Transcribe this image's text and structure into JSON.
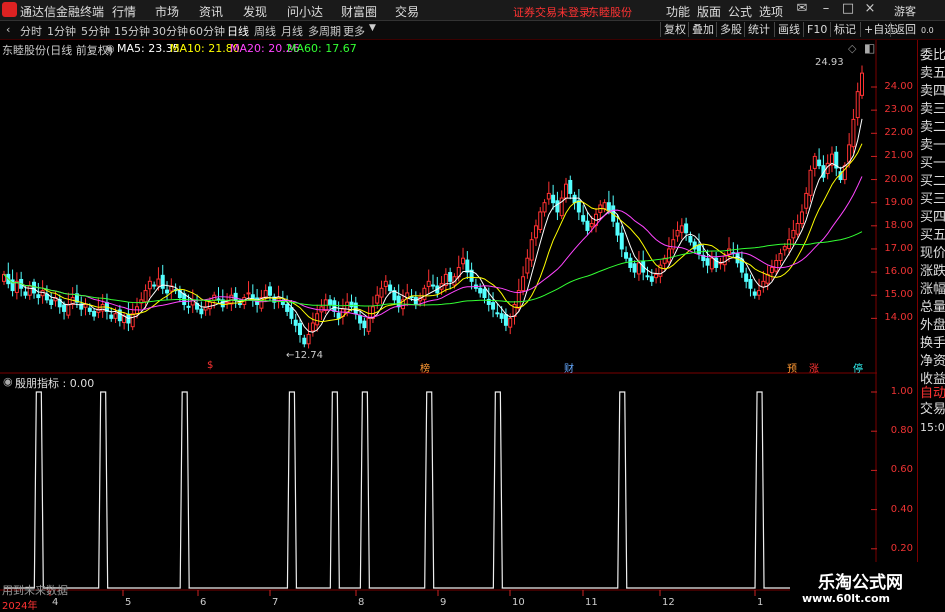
{
  "app": {
    "title": "通达信金融终端"
  },
  "menu": [
    "行情",
    "市场",
    "资讯",
    "发现",
    "问小达",
    "财富圈",
    "交易"
  ],
  "warning": "证券交易未登录",
  "stock_name": "东睦股份",
  "top_right": [
    "功能",
    "版面",
    "公式",
    "选项"
  ],
  "user": "游客",
  "periods": [
    "分时",
    "1分钟",
    "5分钟",
    "15分钟",
    "30分钟",
    "60分钟",
    "日线",
    "周线",
    "月线",
    "多周期",
    "更多"
  ],
  "active_period": "日线",
  "toolbar_buttons": [
    "复权",
    "叠加",
    "多股",
    "统计",
    "画线",
    "F10",
    "标记",
    "+自选",
    "返回"
  ],
  "chart_label": "东睦股份(日线 前复权)",
  "ma": [
    {
      "label": "MA5: 23.35",
      "color": "#ffffff"
    },
    {
      "label": "MA10: 21.80",
      "color": "#ffff00"
    },
    {
      "label": "MA20: 20.26",
      "color": "#ff44ff"
    },
    {
      "label": "MA60: 17.67",
      "color": "#33ff33"
    }
  ],
  "price_axis": [
    "24.00",
    "23.00",
    "22.00",
    "21.00",
    "20.00",
    "19.00",
    "18.00",
    "17.00",
    "16.00",
    "15.00",
    "14.00"
  ],
  "high_label": "24.93",
  "low_label": "12.74",
  "indicator": {
    "label": "殷朋指标 : 0.00",
    "axis": [
      "1.00",
      "0.80",
      "0.60",
      "0.40",
      "0.20"
    ]
  },
  "right_panel": [
    "委比",
    "卖五",
    "卖四",
    "卖三",
    "卖二",
    "卖一",
    "买一",
    "买二",
    "买三",
    "买四",
    "买五",
    "现价",
    "涨跌",
    "涨幅",
    "总量",
    "外盘",
    "换手",
    "净资",
    "收益",
    "自动",
    "交易",
    "15:00"
  ],
  "right_panel_top": "0.0",
  "event_tags": [
    {
      "text": "$",
      "color": "#ff3333"
    },
    {
      "text": "榜",
      "color": "#ff9933"
    },
    {
      "text": "财",
      "color": "#66aaff"
    },
    {
      "text": "预",
      "color": "#ff9933"
    },
    {
      "text": "涨",
      "color": "#ff3333"
    },
    {
      "text": "停",
      "color": "#33ffff"
    }
  ],
  "months": [
    "2024年",
    "4",
    "5",
    "6",
    "7",
    "8",
    "9",
    "10",
    "11",
    "12",
    "1"
  ],
  "footer_hint": "用到未来数据",
  "watermark": {
    "line1": "乐淘公式网",
    "line2": "www.60lt.com"
  },
  "chart_data": {
    "type": "line",
    "title": "",
    "price_range": [
      12.2,
      25.6
    ],
    "closes": [
      15.9,
      15.5,
      15.2,
      15.6,
      15.3,
      15.0,
      15.4,
      15.1,
      14.9,
      15.2,
      14.8,
      14.6,
      14.9,
      14.5,
      14.3,
      14.6,
      14.9,
      14.7,
      14.4,
      14.6,
      14.3,
      14.1,
      14.4,
      14.6,
      14.3,
      14.0,
      14.2,
      13.9,
      14.1,
      13.8,
      14.2,
      14.5,
      14.8,
      15.2,
      15.6,
      15.4,
      15.7,
      15.3,
      15.1,
      15.4,
      15.2,
      14.9,
      14.6,
      14.5,
      14.8,
      14.4,
      14.2,
      14.5,
      14.7,
      15.0,
      14.8,
      14.5,
      14.7,
      15.0,
      14.8,
      14.6,
      14.9,
      15.1,
      14.8,
      14.6,
      14.9,
      15.2,
      15.0,
      14.7,
      14.9,
      14.6,
      14.3,
      14.0,
      13.7,
      13.3,
      12.9,
      13.3,
      13.8,
      14.2,
      14.5,
      14.8,
      14.6,
      14.3,
      14.0,
      14.4,
      14.7,
      14.5,
      14.2,
      13.8,
      13.6,
      14.0,
      14.5,
      15.0,
      15.3,
      15.6,
      15.2,
      14.8,
      14.5,
      14.8,
      15.1,
      14.9,
      14.6,
      14.9,
      15.3,
      15.6,
      15.4,
      15.1,
      15.5,
      15.9,
      15.6,
      15.8,
      16.2,
      16.6,
      16.0,
      15.6,
      15.3,
      15.1,
      14.9,
      14.6,
      14.4,
      14.2,
      14.0,
      13.7,
      14.0,
      14.6,
      15.2,
      15.8,
      16.6,
      17.4,
      18.0,
      18.6,
      19.0,
      19.4,
      19.0,
      18.6,
      19.2,
      19.8,
      19.4,
      19.0,
      18.6,
      18.2,
      17.8,
      18.1,
      18.5,
      18.9,
      19.0,
      18.7,
      18.2,
      17.6,
      17.0,
      16.6,
      16.2,
      16.0,
      16.4,
      16.0,
      15.8,
      15.6,
      15.9,
      16.3,
      16.6,
      17.0,
      17.4,
      17.8,
      18.0,
      17.7,
      17.3,
      17.0,
      16.8,
      16.5,
      16.3,
      16.6,
      16.2,
      16.4,
      16.7,
      17.0,
      16.8,
      16.4,
      16.0,
      15.6,
      15.3,
      15.0,
      15.2,
      15.6,
      15.9,
      16.2,
      16.5,
      16.8,
      17.1,
      17.4,
      17.8,
      18.1,
      18.6,
      19.4,
      20.4,
      21.0,
      20.6,
      20.1,
      20.7,
      21.1,
      20.5,
      20.0,
      20.6,
      21.5,
      22.6,
      23.8,
      24.6
    ],
    "ma_series": [
      "MA5",
      "MA10",
      "MA20",
      "MA60"
    ],
    "indicator_pulses_at_bar": [
      8,
      23,
      42,
      67,
      77,
      84,
      99,
      115,
      144,
      176
    ],
    "indicator_range": [
      0,
      1
    ]
  }
}
